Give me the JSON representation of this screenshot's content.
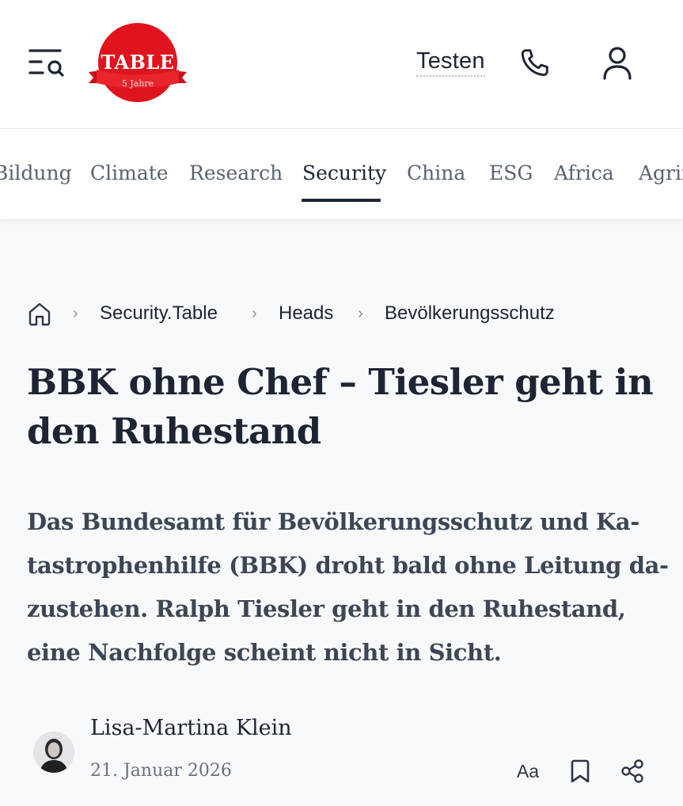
{
  "header": {
    "logo_text": "TABLE",
    "logo_subtext": "5 Jahre",
    "testen_label": "Testen",
    "colors": {
      "logo_red": "#e0141e",
      "text_dark": "#1d2433"
    },
    "icons": [
      "menu-search-icon",
      "phone-icon",
      "user-icon"
    ]
  },
  "nav": {
    "items": [
      {
        "label": "Bildung",
        "active": false
      },
      {
        "label": "Climate",
        "active": false
      },
      {
        "label": "Research",
        "active": false
      },
      {
        "label": "Security",
        "active": true
      },
      {
        "label": "China",
        "active": false
      },
      {
        "label": "ESG",
        "active": false
      },
      {
        "label": "Africa",
        "active": false
      },
      {
        "label": "Agrifood",
        "active": false
      }
    ]
  },
  "breadcrumb": {
    "items": [
      "Security.Table",
      "Heads",
      "Bevölkerungsschutz"
    ],
    "separator": "›",
    "home_icon": "home-icon"
  },
  "article": {
    "title": "BBK ohne Chef – Tiesler geht in den Ruhestand",
    "lead_lines": [
      "Das Bundesamt für Bevölkerungsschutz und Ka-",
      "tastrophenhilfe (BBK) droht bald ohne Leitung da-",
      "zustehen. Ralph Tiesler geht in den Ruhestand,",
      "eine Nachfolge scheint nicht in Sicht."
    ],
    "author": "Lisa-Martina Klein",
    "date": "21. Januar 2026",
    "font_size_label": "Aa",
    "tool_icons": [
      "font-size-icon",
      "bookmark-icon",
      "share-icon"
    ]
  }
}
